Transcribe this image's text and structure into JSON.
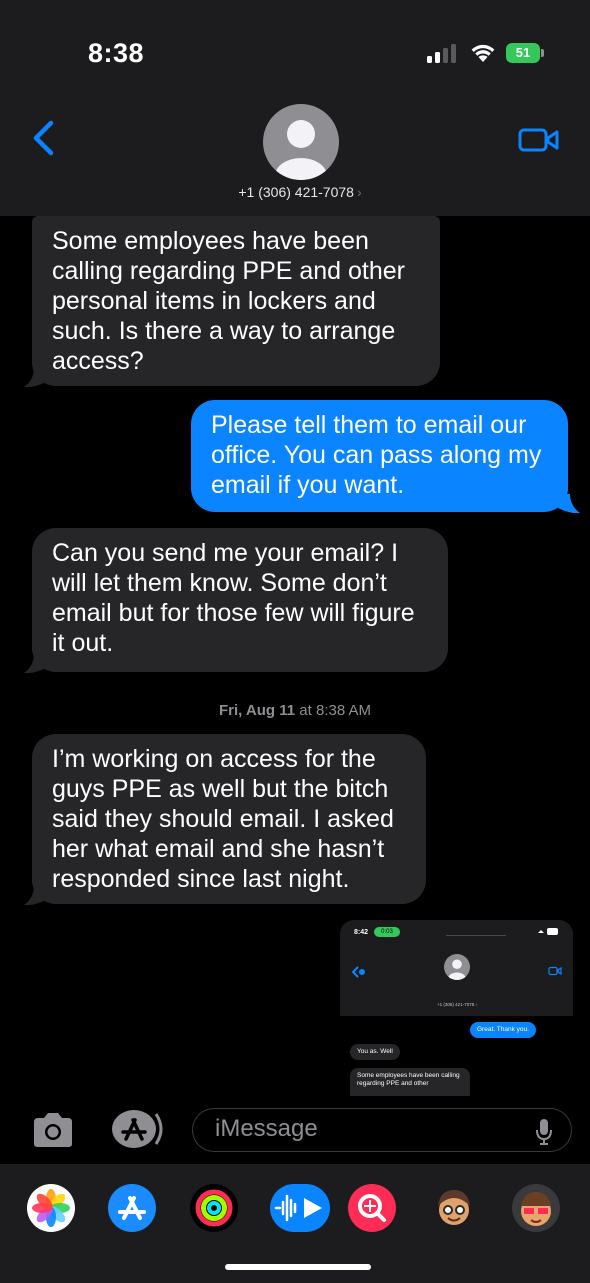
{
  "status_bar": {
    "time": "8:38",
    "battery": "51"
  },
  "header": {
    "contact": "+1 (306) 421-7078",
    "chevron": "›",
    "back_icon": "chevron-left-icon",
    "video_icon": "video-camera-icon"
  },
  "messages": [
    {
      "direction": "incoming",
      "text": "Some employees have been calling regarding PPE and other personal items in lockers and such.   Is there a way to arrange access?"
    },
    {
      "direction": "outgoing",
      "text": "Please tell them to email our office. You can pass along my email if you want."
    },
    {
      "direction": "incoming",
      "text": "Can you send me your email?  I will let them know.  Some don’t email but for those few will figure it out."
    },
    {
      "direction": "timestamp",
      "day": "Fri, Aug 11",
      "time": "at 8:38 AM"
    },
    {
      "direction": "incoming",
      "text": "I’m working on access for the guys PPE as well but the bitch said they should email.  I asked her what email and she hasn’t responded since last night."
    }
  ],
  "embedded_screenshot": {
    "time": "8:42",
    "call_time": "0:03",
    "contact": "+1 (306) 421-7078 ›",
    "messages": [
      {
        "direction": "outgoing",
        "text": "Great. Thank you."
      },
      {
        "direction": "incoming",
        "text": "You as. Well"
      },
      {
        "direction": "incoming",
        "text": "Some employees have been calling regarding PPE and other"
      }
    ]
  },
  "input": {
    "placeholder": "iMessage",
    "camera_icon": "camera-icon",
    "apps_icon": "app-store-icon",
    "mic_icon": "microphone-icon"
  },
  "app_drawer": [
    "photos-app-icon",
    "app-store-app-icon",
    "activity-app-icon",
    "audio-message-app-icon",
    "search-images-app-icon",
    "memoji-app-icon",
    "memoji-stickers-app-icon"
  ],
  "colors": {
    "outgoing_bubble": "#0a84ff",
    "incoming_bubble": "#262629",
    "accent": "#0a84ff",
    "battery": "#34c759"
  }
}
